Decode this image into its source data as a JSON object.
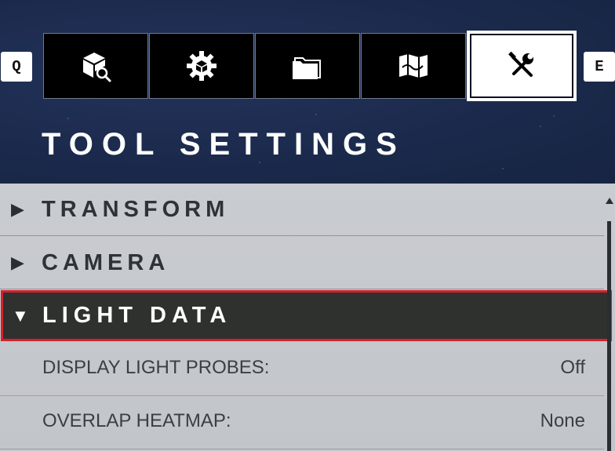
{
  "keys": {
    "prev": "Q",
    "next": "E"
  },
  "tabs": [
    {
      "icon": "cube-search-icon",
      "active": false
    },
    {
      "icon": "gear-cube-icon",
      "active": false
    },
    {
      "icon": "folder-icon",
      "active": false
    },
    {
      "icon": "map-icon",
      "active": false
    },
    {
      "icon": "tools-icon",
      "active": true
    }
  ],
  "page_title": "TOOL SETTINGS",
  "sections": [
    {
      "label": "TRANSFORM",
      "expanded": false
    },
    {
      "label": "CAMERA",
      "expanded": false
    },
    {
      "label": "LIGHT DATA",
      "expanded": true
    }
  ],
  "light_data_settings": [
    {
      "name": "DISPLAY LIGHT PROBES:",
      "value": "Off"
    },
    {
      "name": "OVERLAP HEATMAP:",
      "value": "None"
    }
  ],
  "colors": {
    "highlight_border": "#d6202b",
    "expanded_bg": "#2f312f",
    "header_bg": "#1b2a4c"
  },
  "glyphs": {
    "collapsed": "▶",
    "expanded": "▼"
  }
}
